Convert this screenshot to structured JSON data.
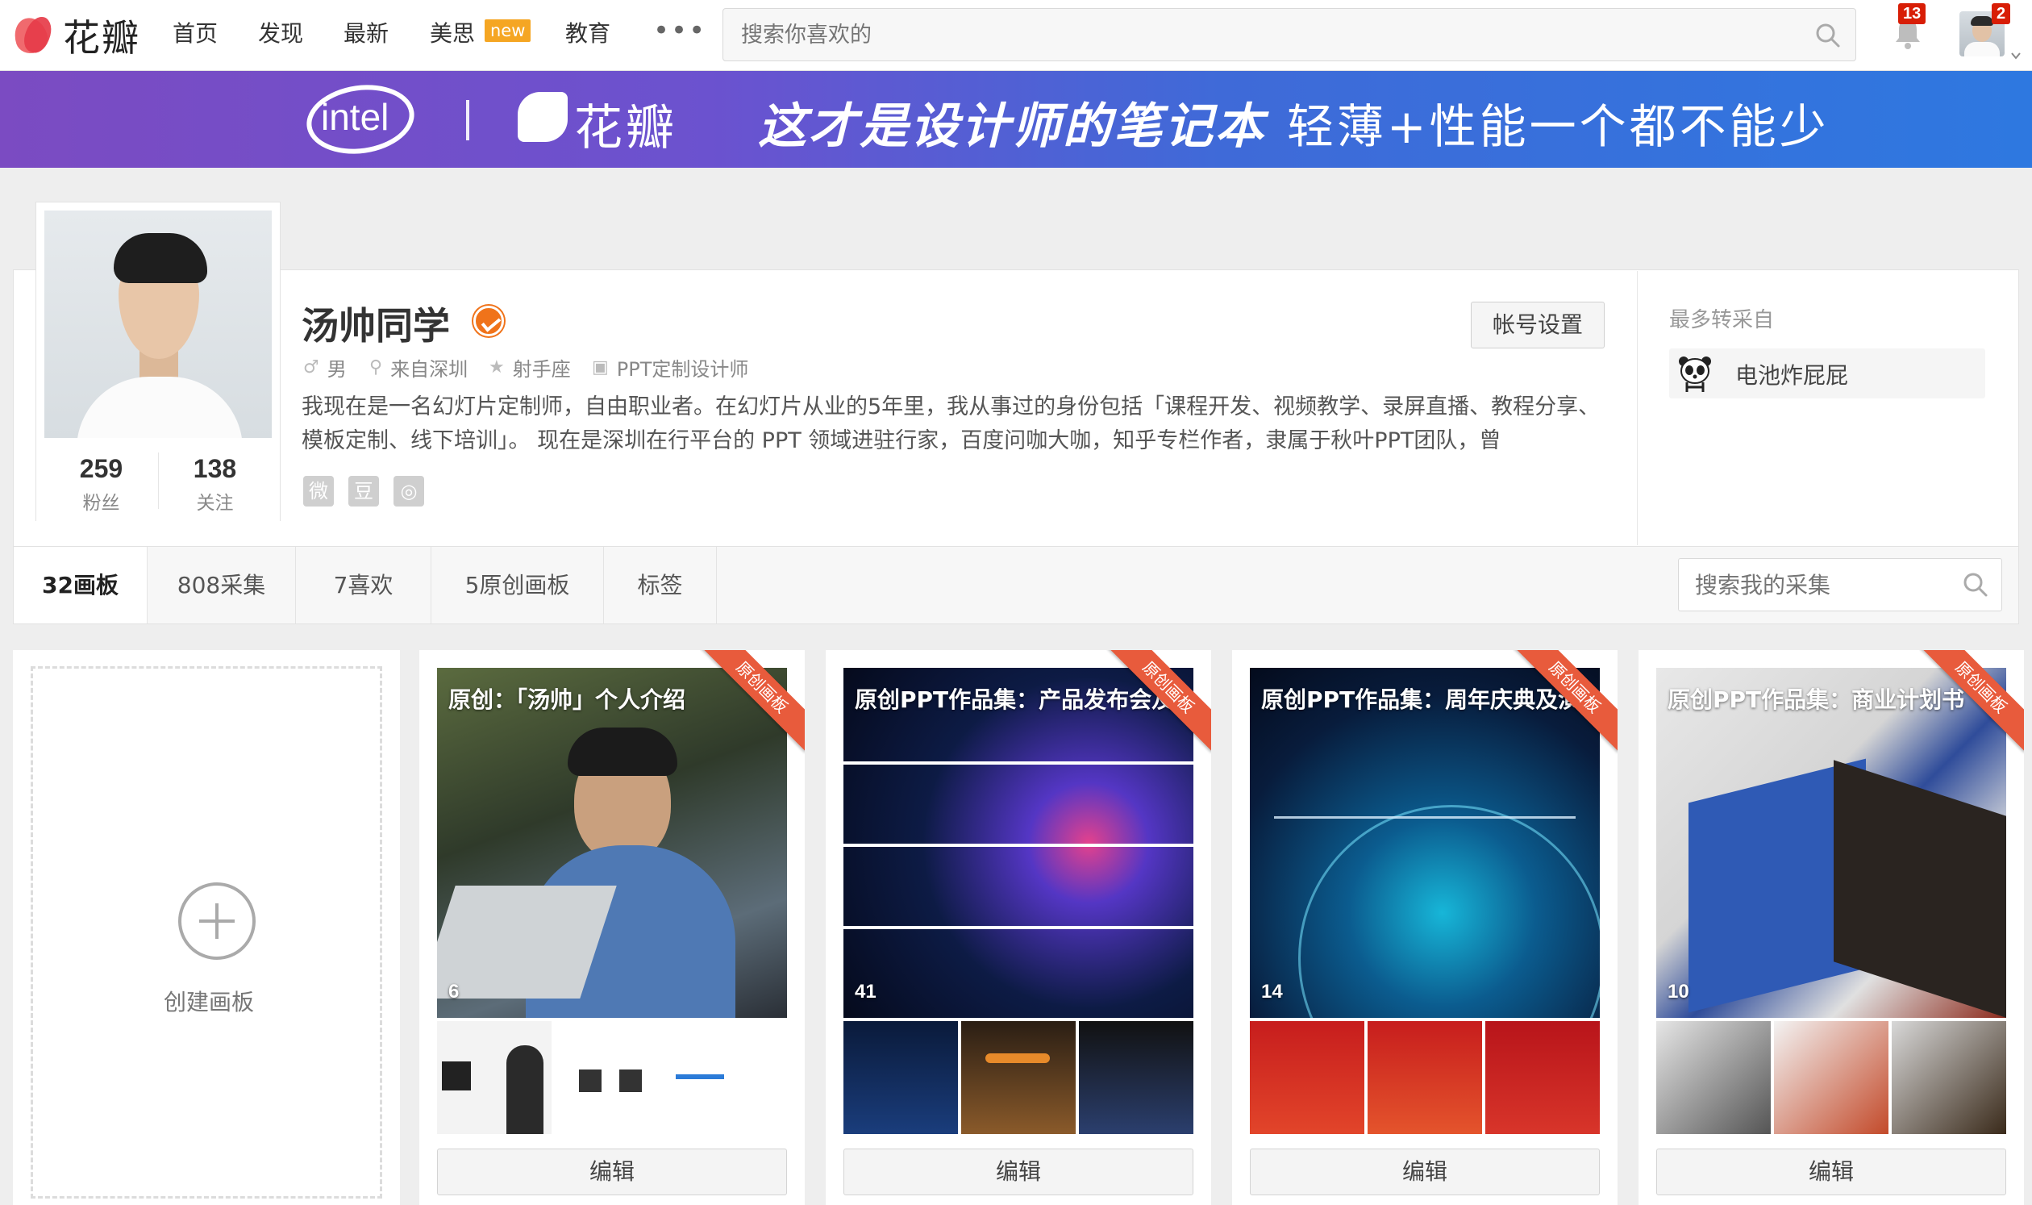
{
  "nav": {
    "logo_text": "花瓣",
    "items": [
      "首页",
      "发现",
      "最新",
      "美思",
      "教育"
    ],
    "new_badge": "new",
    "more": "•••",
    "search_placeholder": "搜索你喜欢的",
    "notification_count": "13",
    "message_count": "2"
  },
  "banner": {
    "partner": "intel",
    "brand": "花瓣",
    "slogan1": "这才是设计师的笔记本",
    "slogan2": "轻薄+性能一个都不能少"
  },
  "profile": {
    "name": "汤帅同学",
    "gender": "男",
    "location": "来自深圳",
    "zodiac": "射手座",
    "job": "PPT定制设计师",
    "bio": "我现在是一名幻灯片定制师，自由职业者。在幻灯片从业的5年里，我从事过的身份包括「课程开发、视频教学、录屏直播、教程分享、模板定制、线下培训」。 现在是深圳在行平台的 PPT 领域进驻行家，百度问咖大咖，知乎专栏作者，隶属于秋叶PPT团队，曾",
    "followers": "259",
    "followers_label": "粉丝",
    "following": "138",
    "following_label": "关注",
    "settings_button": "帐号设置",
    "social": [
      "微",
      "豆",
      "◎"
    ],
    "most_from_label": "最多转采自",
    "most_from_user": "电池炸屁屁"
  },
  "tabs": {
    "items": [
      "32画板",
      "808采集",
      "7喜欢",
      "5原创画板",
      "标签"
    ],
    "active": 0,
    "search_placeholder": "搜索我的采集"
  },
  "create_board": {
    "label": "创建画板"
  },
  "boards": [
    {
      "title": "原创：「汤帅」个人介绍",
      "count": "6",
      "ribbon": "原创画板",
      "edit": "编辑"
    },
    {
      "title": "原创PPT作品集：产品发布会及",
      "count": "41",
      "ribbon": "原创画板",
      "edit": "编辑"
    },
    {
      "title": "原创PPT作品集：周年庆典及演",
      "count": "14",
      "ribbon": "原创画板",
      "edit": "编辑"
    },
    {
      "title": "原创PPT作品集：商业计划书",
      "count": "10",
      "ribbon": "原创画板",
      "edit": "编辑"
    }
  ],
  "colors": {
    "accent_red": "#e85b3c",
    "verified_orange": "#f0731a",
    "badge_red": "#d81e06",
    "new_badge": "#f5a623"
  }
}
